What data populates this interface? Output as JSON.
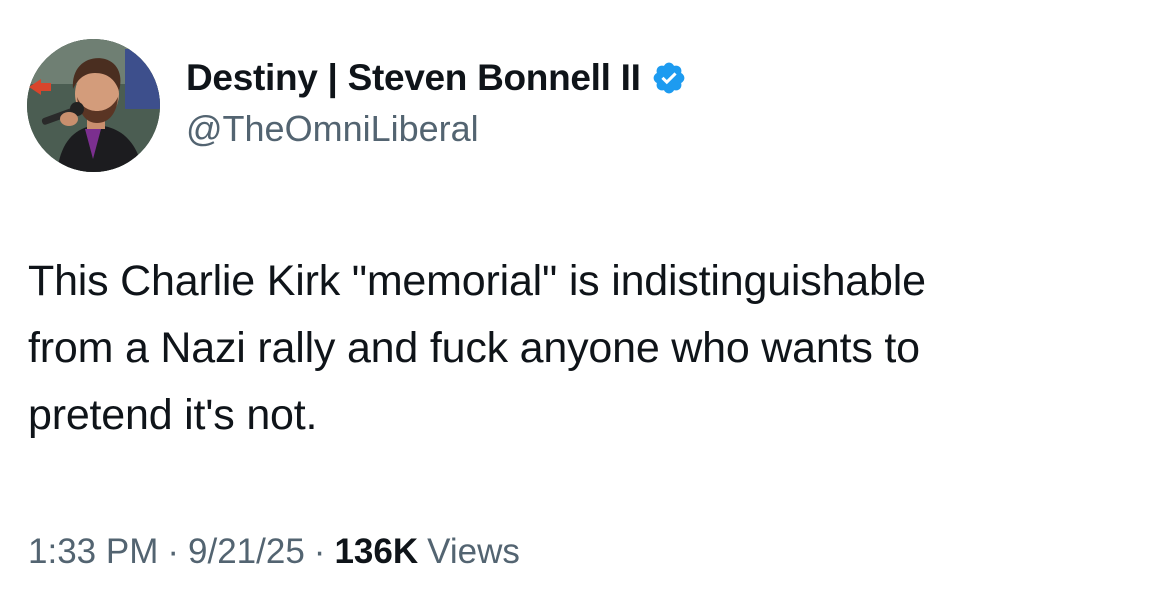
{
  "author": {
    "display_name": "Destiny | Steven Bonnell II",
    "handle": "@TheOmniLiberal",
    "verified_badge_icon": "verified-checkmark-icon",
    "verified_color": "#1d9bf0"
  },
  "tweet": {
    "text": "This Charlie Kirk \"memorial\" is indistinguishable\nfrom a Nazi rally and fuck anyone who wants to\npretend it's not."
  },
  "meta": {
    "time": "1:33 PM",
    "separator": "·",
    "date": "9/21/25",
    "views_count": "136K",
    "views_label": "Views"
  },
  "colors": {
    "text_primary": "#0f1419",
    "text_secondary": "#536471",
    "background": "#ffffff"
  }
}
